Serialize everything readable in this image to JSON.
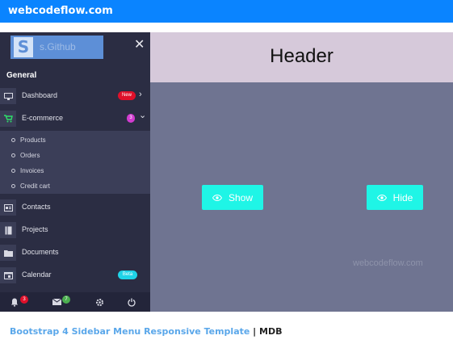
{
  "topbar": {
    "brand": "webcodeflow.com"
  },
  "sidebar": {
    "logo_letter": "S",
    "logo_text": "s.Github",
    "close_glyph": "✕",
    "section_label": "General",
    "items": [
      {
        "label": "Dashboard",
        "badge": "New",
        "badge_color": "#e0102a",
        "chevron": "›"
      },
      {
        "label": "E-commerce",
        "badge": "3",
        "badge_color": "#d23cd0",
        "chevron": "⌄"
      },
      {
        "label": "Contacts"
      },
      {
        "label": "Projects"
      },
      {
        "label": "Documents"
      },
      {
        "label": "Calendar",
        "badge": "Beta",
        "badge_color": "#1fd3e8"
      }
    ],
    "submenu": [
      "Products",
      "Orders",
      "Invoices",
      "Credit cart"
    ],
    "footer": {
      "notify_badge": "3",
      "mail_badge": "7"
    }
  },
  "header": {
    "title": "Header"
  },
  "buttons": {
    "show": "Show",
    "hide": "Hide"
  },
  "watermark": "webcodeflow.com",
  "caption": {
    "link_text": "Bootstrap 4 Sidebar Menu Responsive Template",
    "separator": " | ",
    "suffix": "MDB"
  },
  "colors": {
    "accent": "#0a84ff",
    "button": "#1ff5e6",
    "sidebar": "#2b2d43",
    "content": "#6f7491",
    "header": "#d6c9da"
  }
}
